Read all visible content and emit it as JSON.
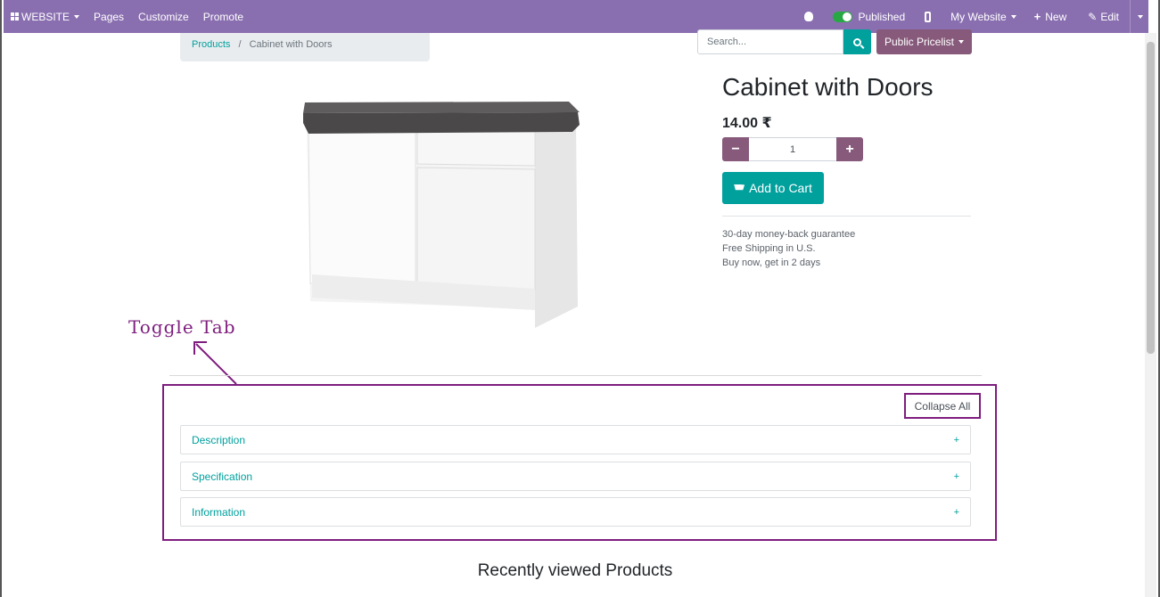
{
  "topbar": {
    "website_label": "WEBSITE",
    "pages_label": "Pages",
    "customize_label": "Customize",
    "promote_label": "Promote",
    "published_label": "Published",
    "my_website_label": "My Website",
    "new_label": "New",
    "edit_label": "Edit"
  },
  "breadcrumb": {
    "parent": "Products",
    "separator": "/",
    "current": "Cabinet with Doors"
  },
  "search": {
    "placeholder": "Search..."
  },
  "pricelist": {
    "label": "Public Pricelist"
  },
  "product": {
    "title": "Cabinet with Doors",
    "price": "14.00 ₹",
    "quantity": "1",
    "add_to_cart": "Add to Cart",
    "notes": [
      "30-day money-back guarantee",
      "Free Shipping in U.S.",
      "Buy now, get in 2 days"
    ]
  },
  "annotation": {
    "label": "Toggle Tab"
  },
  "tabs": {
    "collapse_all": "Collapse All",
    "items": [
      {
        "label": "Description",
        "icon": "+"
      },
      {
        "label": "Specification",
        "icon": "+"
      },
      {
        "label": "Information",
        "icon": "+"
      }
    ]
  },
  "recently_viewed": {
    "title": "Recently viewed Products"
  },
  "colors": {
    "topbar": "#8a6fb0",
    "primary_teal": "#00a09d",
    "secondary_purple": "#875a7b",
    "annotation": "#7e1d7e"
  }
}
